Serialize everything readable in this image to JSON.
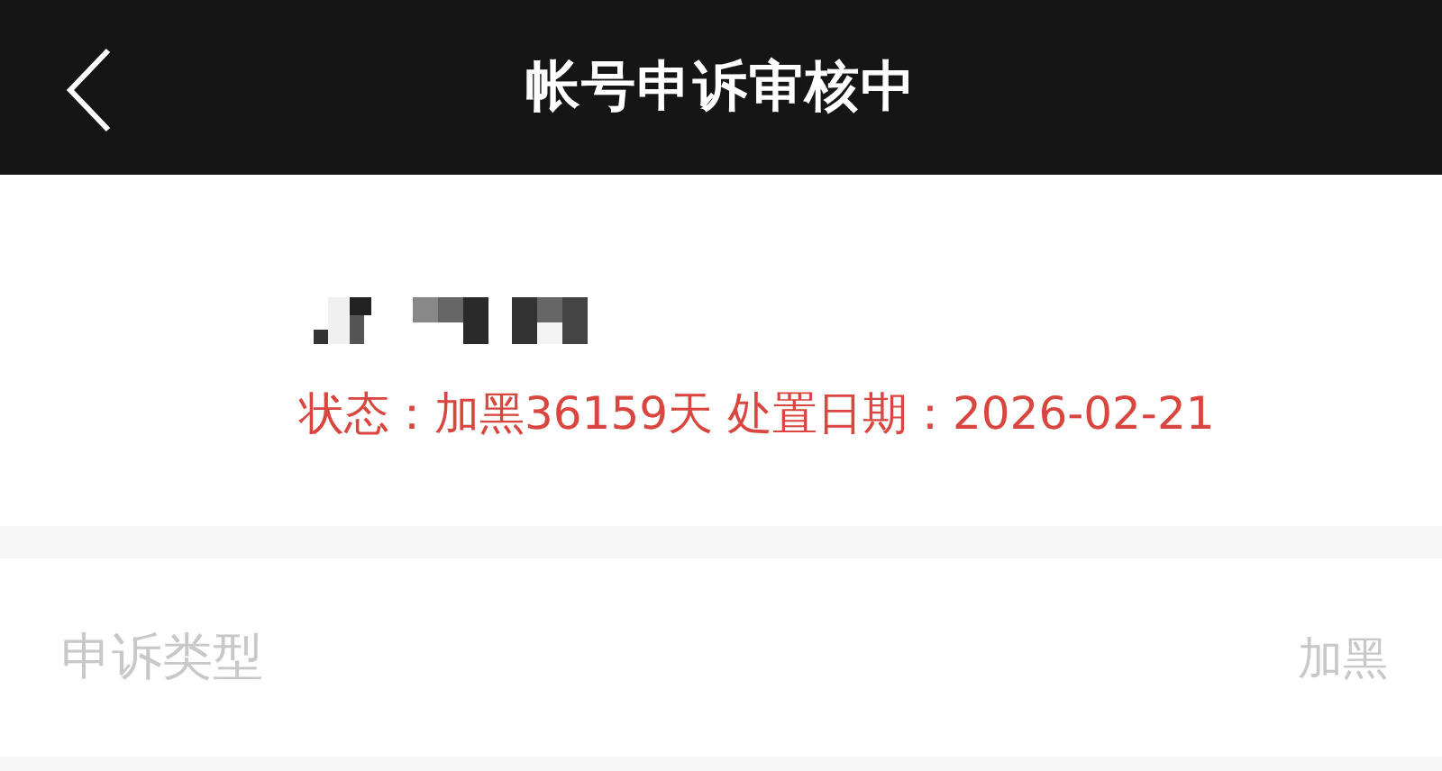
{
  "header": {
    "title": "帐号申诉审核中"
  },
  "account": {
    "status": "状态：加黑36159天 处置日期：2026-02-21"
  },
  "rows": [
    {
      "label": "申诉类型",
      "value": "加黑"
    }
  ]
}
